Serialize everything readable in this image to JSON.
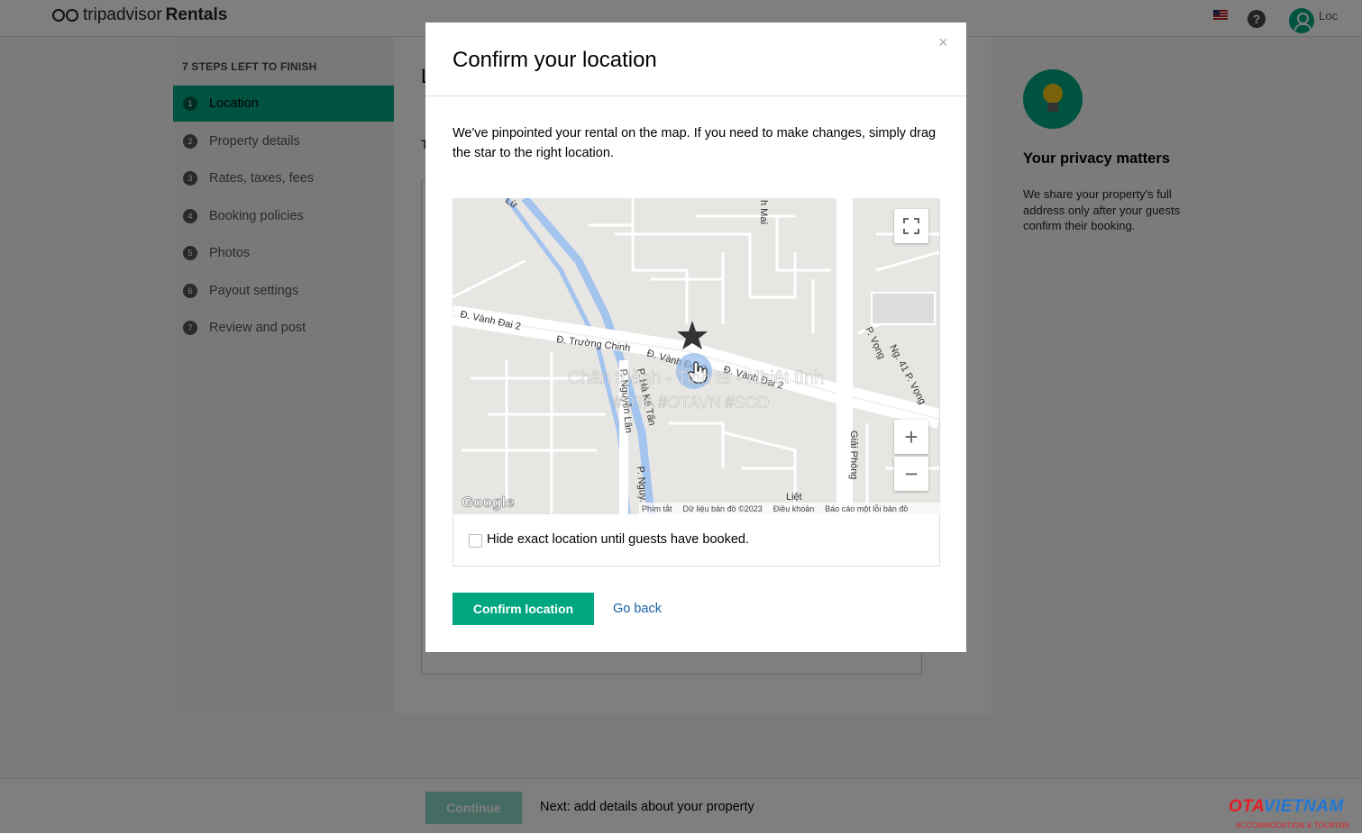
{
  "header": {
    "logo_trip": "tripadvisor",
    "logo_rentals": "Rentals",
    "help_label": "?",
    "user_name": "Loc"
  },
  "sidebar": {
    "steps_left": "7 STEPS LEFT TO FINISH",
    "steps": [
      {
        "num": "1",
        "label": "Location"
      },
      {
        "num": "2",
        "label": "Property details"
      },
      {
        "num": "3",
        "label": "Rates, taxes, fees"
      },
      {
        "num": "4",
        "label": "Booking policies"
      },
      {
        "num": "5",
        "label": "Photos"
      },
      {
        "num": "6",
        "label": "Payout settings"
      },
      {
        "num": "7",
        "label": "Review and post"
      }
    ]
  },
  "background": {
    "title_fragment": "L",
    "text_fragment": "T"
  },
  "privacy": {
    "title": "Your privacy matters",
    "text": "We share your property's full address only after your guests confirm their booking."
  },
  "footer": {
    "continue_label": "Continue",
    "next_text": "Next: add details about your property"
  },
  "watermark": {
    "ota": "OTA",
    "vietnam": "VIETNAM",
    "sub": "ACCOMMODATION & TOURISM"
  },
  "modal": {
    "close": "×",
    "title": "Confirm your location",
    "description": "We've pinpointed your rental on the map. If you need to make changes, simply drag the star to the right location.",
    "checkbox_label": "Hide exact location until guests have booked.",
    "confirm_label": "Confirm location",
    "go_back_label": "Go back"
  },
  "map": {
    "streets": [
      "Đ. Vành Đai 2",
      "Đ. Trường Chinh",
      "Đ. Vành Đai 2",
      "Đ. Vành Đai 2",
      "P. Vọng",
      "Ng. 41 P. Vọng",
      "Giải Phóng",
      "P. Hà Kế Tấn",
      "P. Nguyễn Lân",
      "P. Nguy...",
      "Lừ",
      "h Mai",
      "Liệt"
    ],
    "overlay_text_1": "Chân thành - Tinh tế - Nhiệt tình",
    "overlay_text_2": "#OTA #OTAVN #SCO",
    "google_label": "Google",
    "attribution": [
      "Phím tắt",
      "Dữ liệu bản đồ ©2023",
      "Điều khoản",
      "Báo cáo một lỗi bản đồ"
    ],
    "zoom_in": "+",
    "zoom_out": "−"
  }
}
